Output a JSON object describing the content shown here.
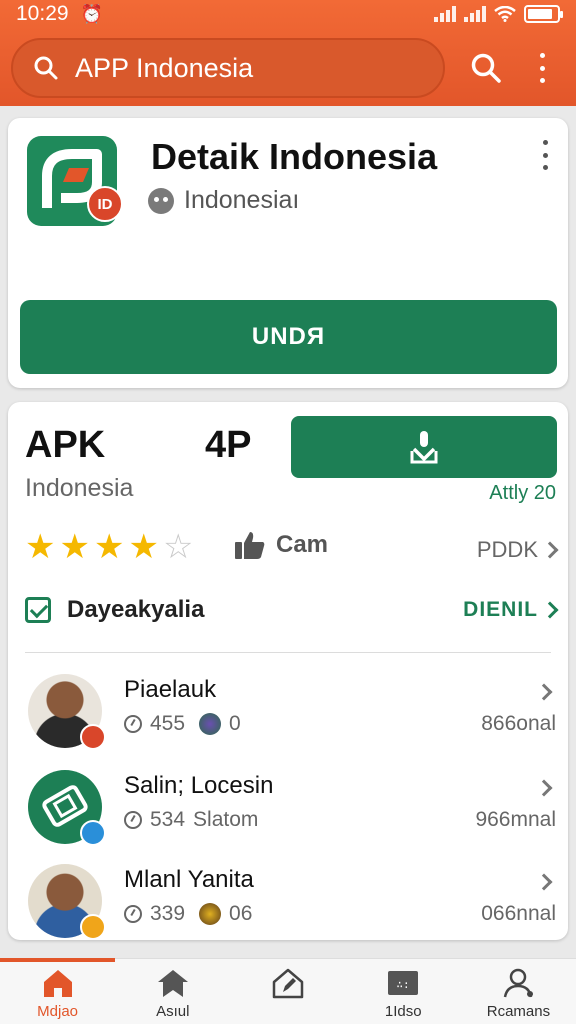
{
  "status_bar": {
    "time": "10:29",
    "battery_level": 0.85
  },
  "search": {
    "query": "APP Indonesia"
  },
  "app_card": {
    "title": "Detaik Indonesia",
    "developer": "Indonesiaı",
    "logo_badge": "ID",
    "install_label": "UNDЯ"
  },
  "info_card": {
    "apk_label": "APK",
    "version_label": "4P",
    "subtitle": "Indonesia",
    "download_meta": "Attly 20",
    "rating_stars": 4,
    "rating_max": 5,
    "like_label": "Cam",
    "pddk_label": "PDDK",
    "verified_label": "Dayeakyalia",
    "detail_link": "DIENIL"
  },
  "reviews": [
    {
      "name": "Piaelauk",
      "count": "455",
      "extra": "0",
      "right": "866onal"
    },
    {
      "name": "Salin; Locesin",
      "count": "534",
      "extra": "Slatom",
      "right": "966mnal"
    },
    {
      "name": "Mlanl Yanita",
      "count": "339",
      "extra": "06",
      "right": "066nnal"
    }
  ],
  "bottom_nav": [
    {
      "label": "Mdjao",
      "icon": "home-icon",
      "active": true
    },
    {
      "label": "Asıul",
      "icon": "bookmark-icon",
      "active": false
    },
    {
      "label": "",
      "icon": "edit-home-icon",
      "active": false
    },
    {
      "label": "1Idso",
      "icon": "grid-icon",
      "active": false
    },
    {
      "label": "Rcamans",
      "icon": "profile-icon",
      "active": false
    }
  ],
  "colors": {
    "accent": "#e2562a",
    "primary_green": "#1d7f55",
    "star": "#f5b800"
  }
}
